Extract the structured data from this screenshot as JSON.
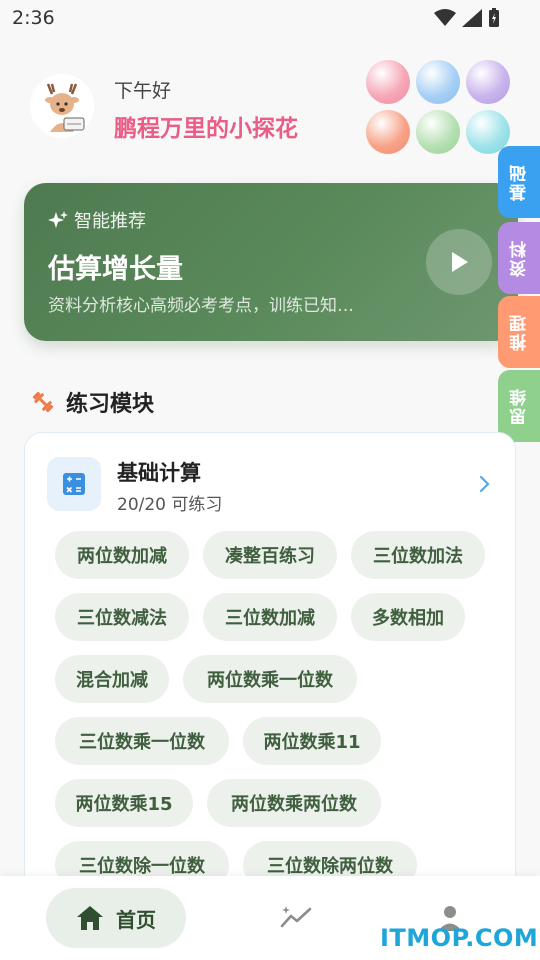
{
  "status_bar": {
    "time": "2:36"
  },
  "header": {
    "greeting": "下午好",
    "username": "鹏程万里的小探花"
  },
  "bubbles": [
    "#f6a8b8",
    "#a8d0f5",
    "#c9b5ec",
    "#f7a48a",
    "#b6e0b4",
    "#9fe3ea"
  ],
  "recommend": {
    "tag": "智能推荐",
    "title": "估算增长量",
    "description": "资料分析核心高频必考考点，训练已知…"
  },
  "side_tabs": [
    {
      "label": "基础",
      "color": "#3aa0f0"
    },
    {
      "label": "资料",
      "color": "#b48be3"
    },
    {
      "label": "推理",
      "color": "#ff9a72"
    },
    {
      "label": "思维",
      "color": "#8fd08d"
    }
  ],
  "section": {
    "title": "练习模块"
  },
  "module": {
    "title": "基础计算",
    "subtitle": "20/20 可练习",
    "chips": [
      "两位数加减",
      "凑整百练习",
      "三位数加法",
      "三位数减法",
      "三位数加减",
      "多数相加",
      "混合加减",
      "两位数乘一位数",
      "三位数乘一位数",
      "两位数乘11",
      "两位数乘15",
      "两位数乘两位数",
      "三位数除一位数",
      "三位数除两位数"
    ]
  },
  "bottom_nav": {
    "home_label": "首页"
  },
  "watermark": "ITMOP.COM",
  "colors": {
    "accent_green": "#4f7a50",
    "username_pink": "#e95d87"
  }
}
